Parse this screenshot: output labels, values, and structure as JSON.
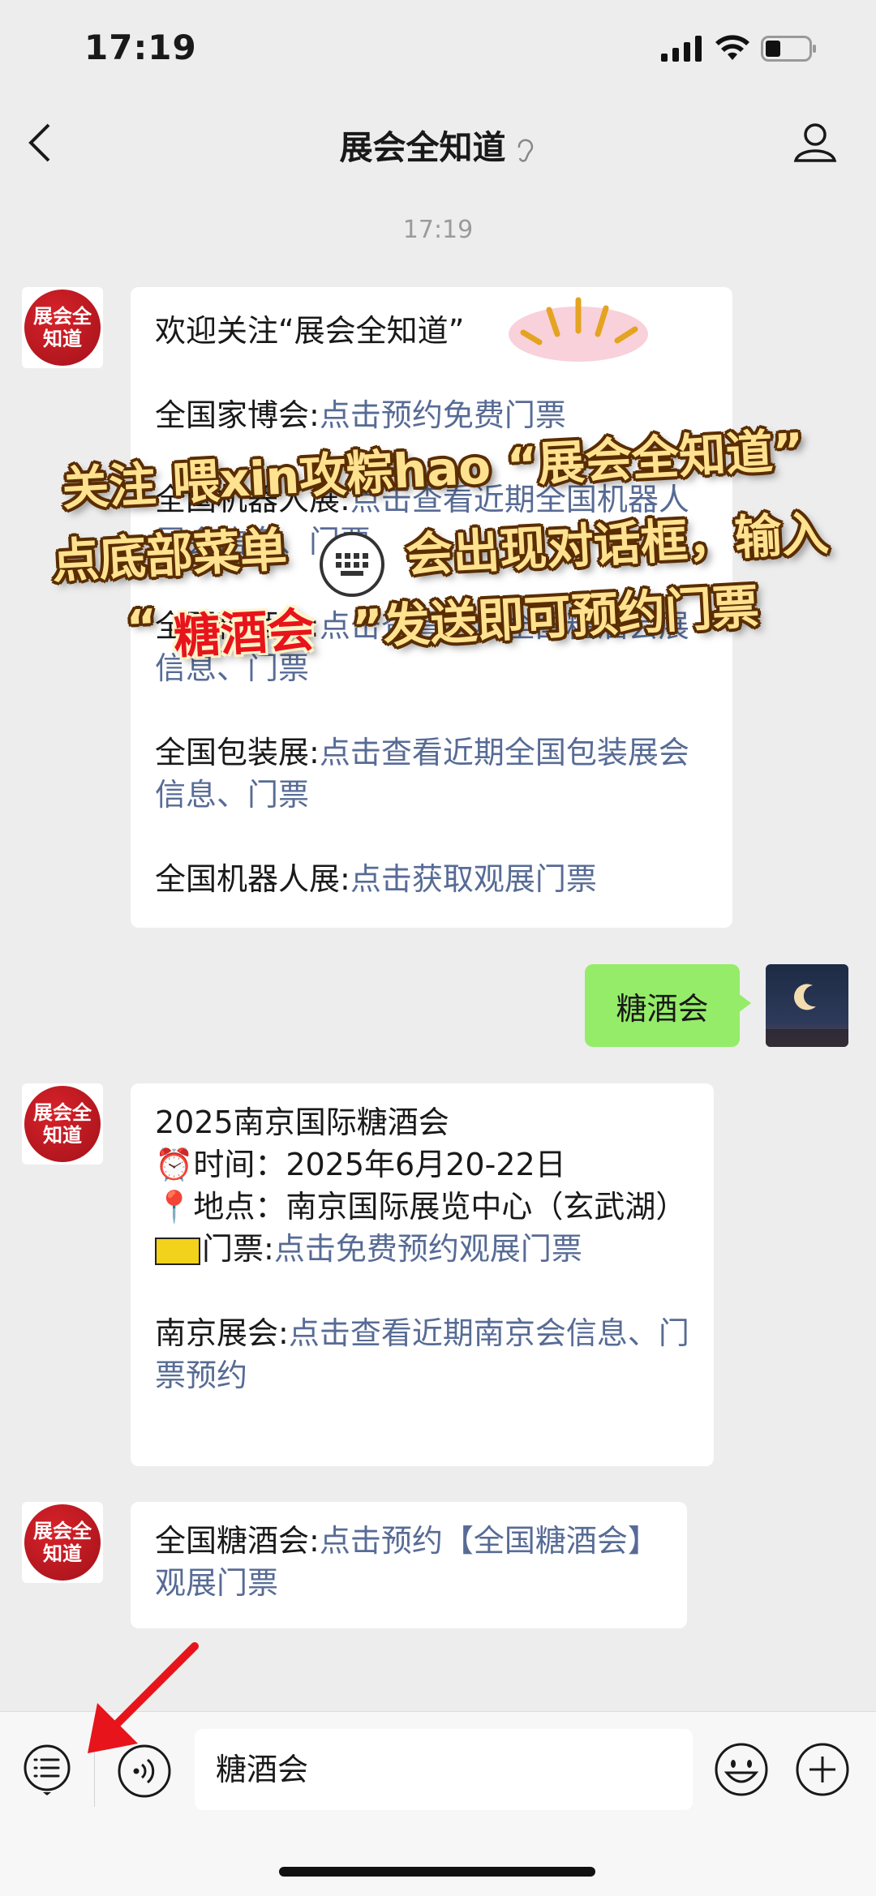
{
  "status_bar": {
    "time": "17:19"
  },
  "nav": {
    "title": "展会全知道"
  },
  "timestamp": "17:19",
  "oa_avatar_text": "展会全知道",
  "message1": {
    "greeting": "欢迎关注“展会全知道”",
    "rows": [
      {
        "label": "全国家博会:",
        "link": "点击预约免费门票"
      },
      {
        "label": "全国机器人展:",
        "link": "点击查看近期全国机器人展会信息、门票"
      },
      {
        "label": "全国糖酒会:",
        "link": "点击查看近期全国糖酒会展信息、门票"
      },
      {
        "label": "全国包装展:",
        "link": "点击查看近期全国包装展会信息、门票"
      },
      {
        "label": "全国机器人展:",
        "link": "点击获取观展门票"
      }
    ]
  },
  "sent_message": "糖酒会",
  "message2": {
    "title": "2025南京国际糖酒会",
    "time_label": "⏰时间：",
    "time_value": "2025年6月20-22日",
    "place_label": "📍地点：",
    "place_value": "南京国际展览中心（玄武湖）",
    "ticket_label": "门票:",
    "ticket_link": "点击免费预约观展门票",
    "nanjing_label": "南京展会:",
    "nanjing_link": "点击查看近期南京会信息、门票预约"
  },
  "message3": {
    "label": "全国糖酒会:",
    "link": "点击预约【全国糖酒会】观展门票"
  },
  "overlay": {
    "line1": "关注 喂xin攻粽hao “展会全知道”",
    "line2a": "点底部菜单",
    "line2b": "会出现对话框，输入",
    "line3a": "“",
    "line3b": "糖酒会",
    "line3c": "”发送即可预约门票"
  },
  "input": {
    "value": "糖酒会"
  },
  "icons": [
    "back-icon",
    "ear-icon",
    "profile-icon",
    "menu-icon",
    "voice-icon",
    "emoji-icon",
    "plus-icon",
    "keyboard-icon",
    "arrow-icon"
  ],
  "colors": {
    "link": "#576b95",
    "sent_bubble": "#95ec69",
    "overlay_text": "#ffe28f",
    "overlay_highlight": "#e8141b"
  }
}
